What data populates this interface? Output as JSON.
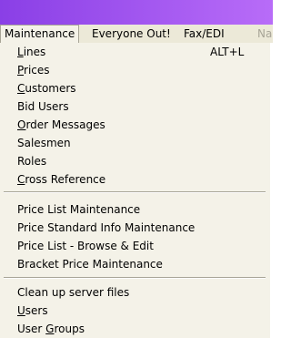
{
  "menubar": {
    "items": [
      {
        "label": "Maintenance",
        "active": true
      },
      {
        "label": "Everyone Out!"
      },
      {
        "label": "Fax/EDI"
      },
      {
        "label": "Na"
      }
    ]
  },
  "dropdown": {
    "groups": [
      [
        {
          "label": "Lines",
          "mnemonic": "L",
          "shortcut": "ALT+L"
        },
        {
          "label": "Prices",
          "mnemonic": "P"
        },
        {
          "label": "Customers",
          "mnemonic": "C"
        },
        {
          "label": "Bid Users"
        },
        {
          "label": "Order Messages",
          "mnemonic": "O"
        },
        {
          "label": "Salesmen"
        },
        {
          "label": "Roles"
        },
        {
          "label": "Cross Reference",
          "mnemonic": "C"
        }
      ],
      [
        {
          "label": "Price List Maintenance"
        },
        {
          "label": "Price Standard Info Maintenance"
        },
        {
          "label": "Price List - Browse & Edit"
        },
        {
          "label": "Bracket Price Maintenance"
        }
      ],
      [
        {
          "label": "Clean up server files"
        },
        {
          "label": "Users",
          "mnemonic": "U"
        },
        {
          "label": "User Groups",
          "mnemonic": "G"
        }
      ]
    ]
  }
}
